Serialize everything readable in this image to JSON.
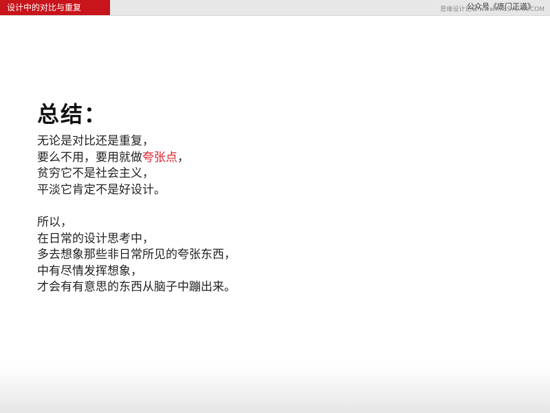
{
  "header": {
    "section_title": "设计中的对比与重复",
    "account_name": "公众号《庞门正道》",
    "watermark": "思缘设计论坛 www.MISSYUAN.COM"
  },
  "summary": {
    "heading": "总结：",
    "paragraph1": {
      "line1": "无论是对比还是重复，",
      "line2_before": "要么不用，要用就做",
      "line2_highlight": "夸张点",
      "line2_after": "，",
      "line3": "贫穷它不是社会主义，",
      "line4": "平淡它肯定不是好设计。"
    },
    "paragraph2": {
      "line1": "所以，",
      "line2": "在日常的设计思考中，",
      "line3": "多去想象那些非日常所见的夸张东西，",
      "line4": "中有尽情发挥想象，",
      "line5": "才会有有意思的东西从脑子中蹦出来。"
    }
  },
  "colors": {
    "brand_red": "#c8141b",
    "highlight_red": "#e0202a"
  }
}
